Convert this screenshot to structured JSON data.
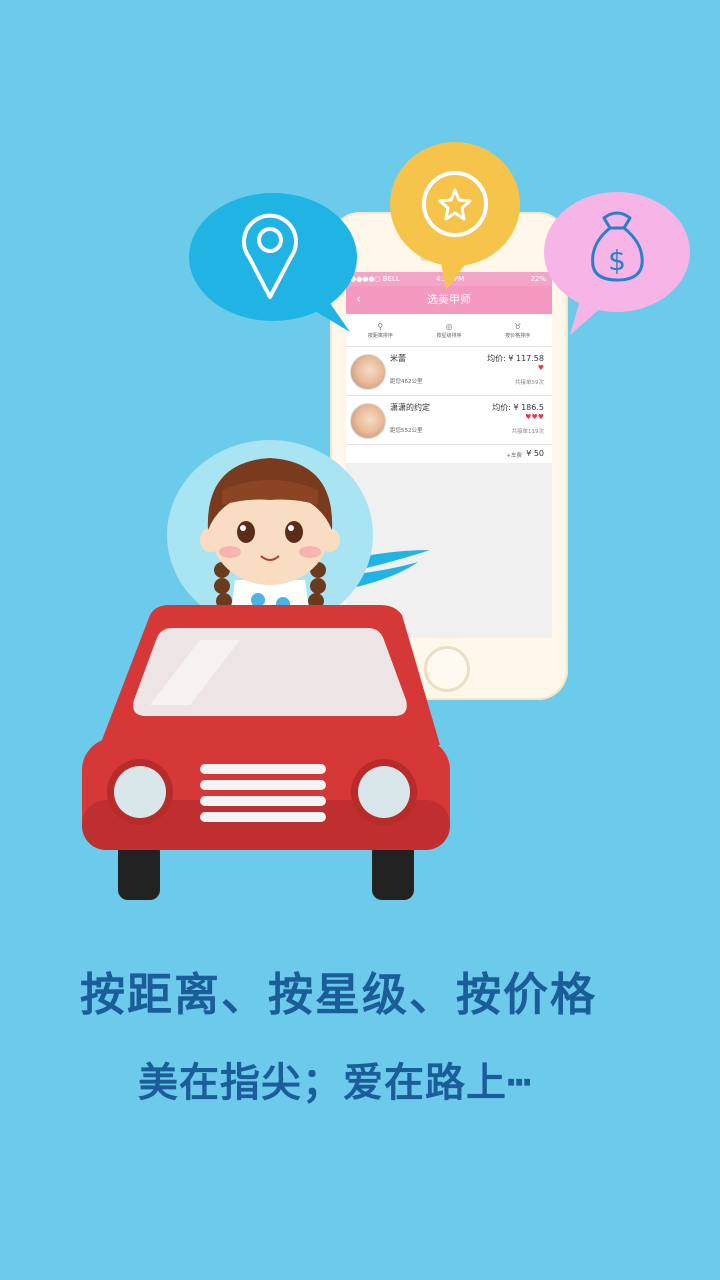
{
  "phone": {
    "status": {
      "carrier": "●●●●○ BELL ",
      "time": "4:21 PM",
      "battery": "22%"
    },
    "nav": {
      "back": "‹",
      "title": "选美甲师"
    },
    "sort": [
      {
        "icon": "location-pin-icon",
        "label": "按距离排序"
      },
      {
        "icon": "star-icon",
        "label": "按星级排序"
      },
      {
        "icon": "money-bag-icon",
        "label": "按价格排序"
      }
    ],
    "list": [
      {
        "name": "米蕾",
        "distance": "距您462公里",
        "price": "均价: ¥ 117.58",
        "hearts": "♥",
        "orders": "共接单59次"
      },
      {
        "name": "潇潇的约定",
        "distance": "距您552公里",
        "price": "均价: ¥ 186.5",
        "hearts": "♥♥♥",
        "orders": "共接单119次"
      }
    ],
    "fare": {
      "label": "+车费",
      "value": "¥ 50"
    }
  },
  "bubbles": [
    {
      "icon": "location-pin-icon",
      "color": "#1fb4e3"
    },
    {
      "icon": "star-icon",
      "color": "#f6c44b"
    },
    {
      "icon": "money-bag-icon",
      "color": "#f6b5e6"
    }
  ],
  "headline": {
    "line1": "按距离、按星级、按价格",
    "line2": "美在指尖；爱在路上┅"
  },
  "colors": {
    "background": "#6ccbea",
    "text": "#1a5d99",
    "accent": "#f49ac1",
    "car": "#d93a3a"
  }
}
